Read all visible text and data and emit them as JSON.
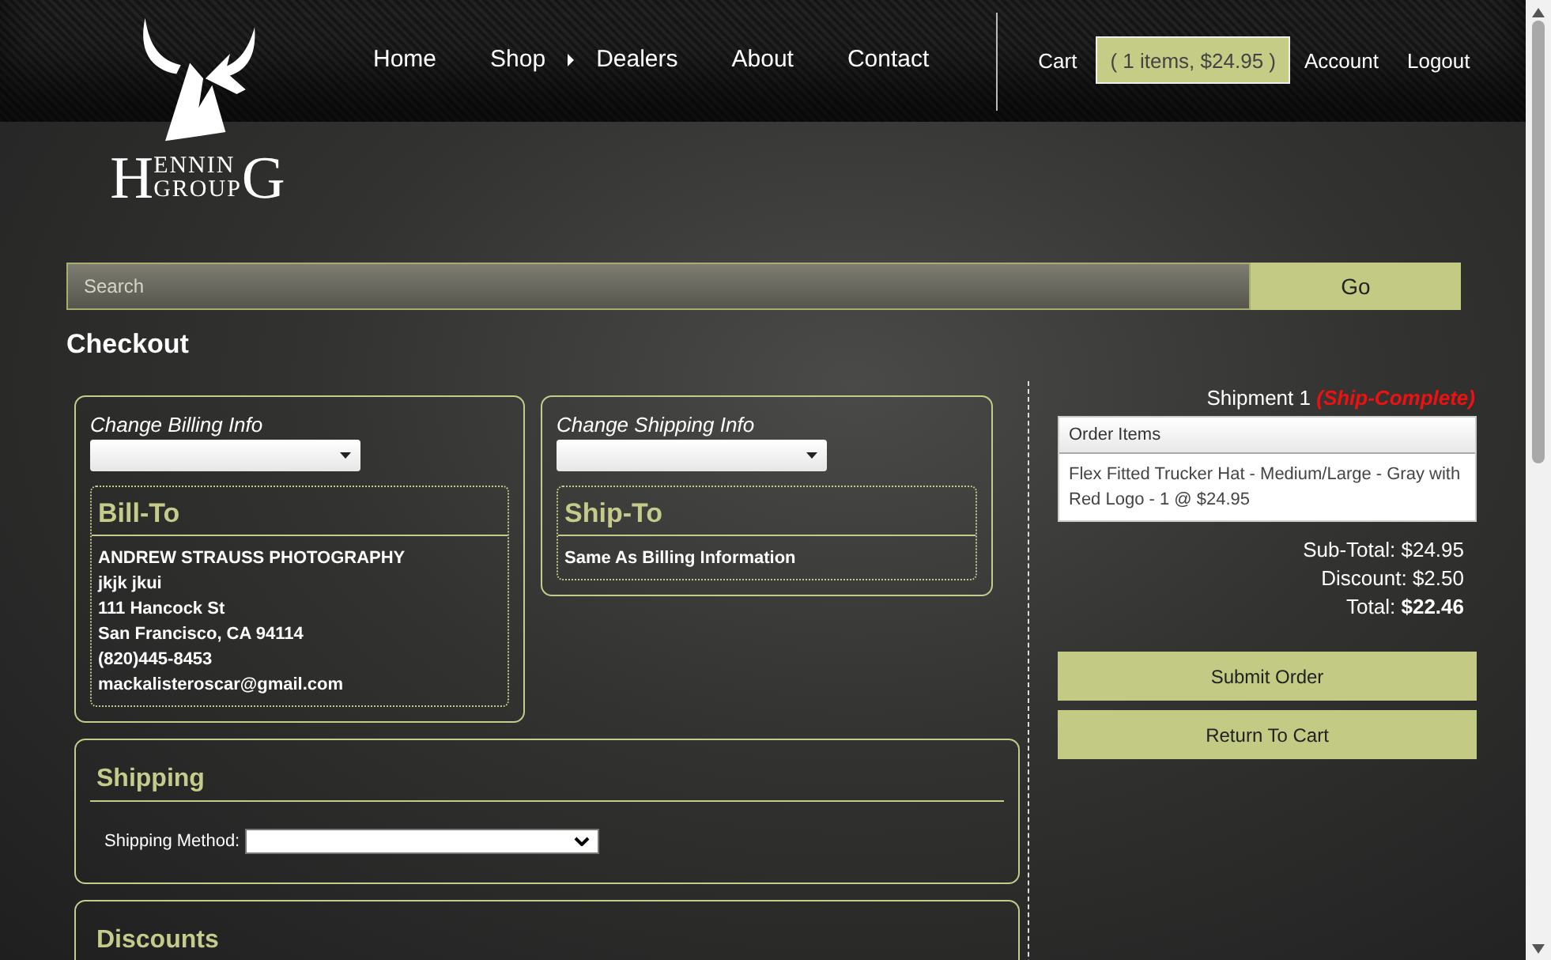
{
  "header": {
    "logo": {
      "initial": "H",
      "top": "ENNIN",
      "bottom": "GROUP",
      "final": "G"
    },
    "nav": [
      {
        "label": "Home",
        "has_submenu": false
      },
      {
        "label": "Shop",
        "has_submenu": true
      },
      {
        "label": "Dealers",
        "has_submenu": false
      },
      {
        "label": "About",
        "has_submenu": false
      },
      {
        "label": "Contact",
        "has_submenu": false
      }
    ],
    "cart_link": "Cart",
    "cart_summary": "( 1 items, $24.95 )",
    "user_links": [
      "Account",
      "Logout"
    ]
  },
  "search": {
    "placeholder": "Search",
    "button": "Go"
  },
  "page_title": "Checkout",
  "billing": {
    "change_label": "Change Billing Info",
    "heading": "Bill-To",
    "lines": [
      "ANDREW STRAUSS PHOTOGRAPHY",
      "jkjk jkui",
      "111 Hancock St",
      "San Francisco, CA 94114",
      "(820)445-8453",
      "mackalisteroscar@gmail.com"
    ]
  },
  "shipping_address": {
    "change_label": "Change Shipping Info",
    "heading": "Ship-To",
    "lines": [
      "Same As Billing Information"
    ]
  },
  "shipping": {
    "heading": "Shipping",
    "method_label": "Shipping Method:"
  },
  "discounts": {
    "heading": "Discounts"
  },
  "shipment": {
    "title": "Shipment 1",
    "status": "(Ship-Complete)",
    "items_header": "Order Items",
    "items": [
      "Flex Fitted Trucker Hat - Medium/Large - Gray with Red Logo  - 1 @ $24.95"
    ],
    "totals": [
      {
        "label": "Sub-Total:",
        "value": "$24.95",
        "emphasis": false
      },
      {
        "label": "Discount:",
        "value": "$2.50",
        "emphasis": false
      },
      {
        "label": "Total:",
        "value": "$22.46",
        "emphasis": true
      }
    ],
    "buttons": [
      "Submit Order",
      "Return To Cart"
    ]
  }
}
